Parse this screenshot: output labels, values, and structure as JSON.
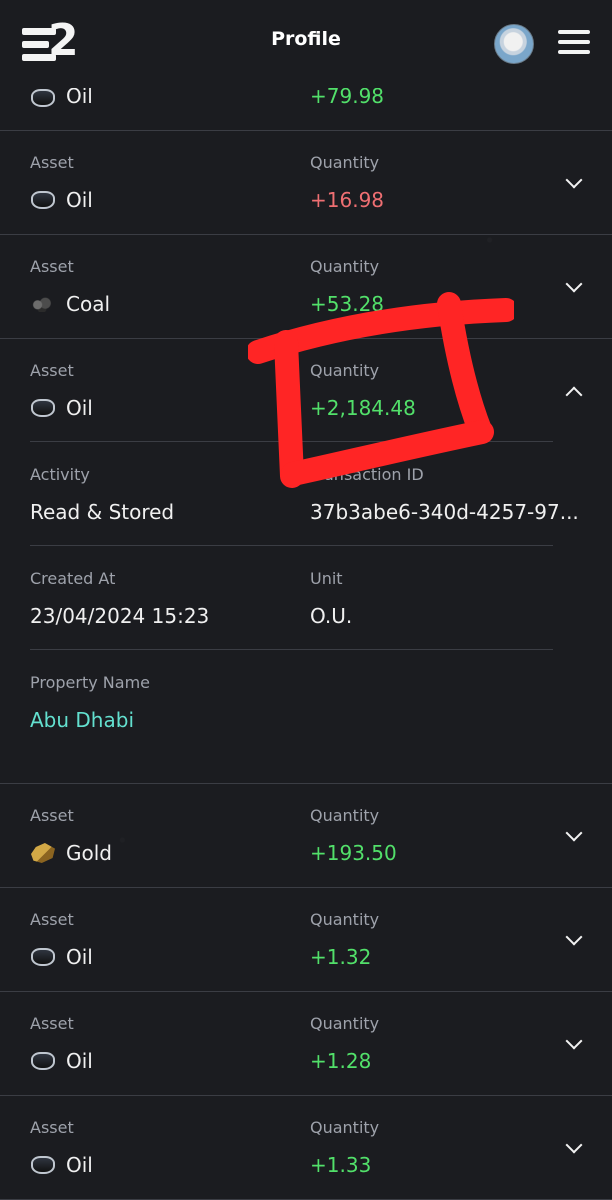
{
  "header": {
    "title": "Profile"
  },
  "transactions": {
    "asset_label": "Asset",
    "quantity_label": "Quantity",
    "items": [
      {
        "asset": "Oil",
        "quantity": "+79.98",
        "quantity_color": "#52e06a",
        "icon": "oil-icon"
      },
      {
        "asset": "Oil",
        "quantity": "+16.98",
        "quantity_color": "#ef6f72",
        "icon": "oil-icon"
      },
      {
        "asset": "Coal",
        "quantity": "+53.28",
        "quantity_color": "#52e06a",
        "icon": "coal-icon"
      },
      {
        "asset": "Oil",
        "quantity": "+2,184.48",
        "quantity_color": "#52e06a",
        "icon": "oil-icon"
      },
      {
        "asset": "Gold",
        "quantity": "+193.50",
        "quantity_color": "#52e06a",
        "icon": "gold-icon"
      },
      {
        "asset": "Oil",
        "quantity": "+1.32",
        "quantity_color": "#52e06a",
        "icon": "oil-icon"
      },
      {
        "asset": "Oil",
        "quantity": "+1.28",
        "quantity_color": "#52e06a",
        "icon": "oil-icon"
      },
      {
        "asset": "Oil",
        "quantity": "+1.33",
        "quantity_color": "#52e06a",
        "icon": "oil-icon"
      }
    ]
  },
  "expanded_details": {
    "activity_label": "Activity",
    "activity_value": "Read & Stored",
    "transaction_id_label": "Transaction ID",
    "transaction_id_value": "37b3abe6-340d-4257-97...",
    "created_at_label": "Created At",
    "created_at_value": "23/04/2024 15:23",
    "unit_label": "Unit",
    "unit_value": "O.U.",
    "property_name_label": "Property Name",
    "property_name_value": "Abu Dhabi"
  },
  "colors": {
    "background": "#1b1c20",
    "divider": "#3b3d44",
    "positive": "#52e06a",
    "negative": "#ef6f72",
    "property": "#63e0cf",
    "annotation": "#ff2525"
  }
}
